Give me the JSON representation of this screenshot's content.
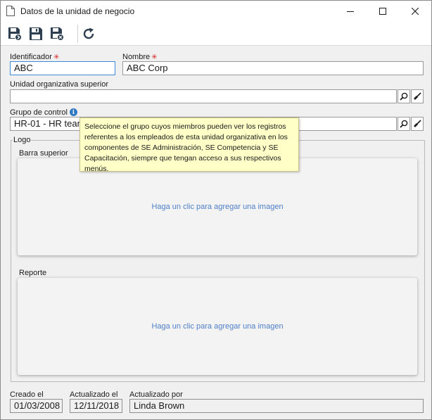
{
  "window": {
    "title": "Datos de la unidad de negocio",
    "title_icon": "document-icon",
    "controls": [
      "minimize-icon",
      "maximize-icon",
      "close-icon"
    ]
  },
  "toolbar": {
    "buttons": [
      {
        "name": "save-and-new-icon"
      },
      {
        "name": "save-icon"
      },
      {
        "name": "save-and-close-icon"
      },
      {
        "name": "refresh-icon"
      }
    ]
  },
  "form": {
    "identificador": {
      "label": "Identificador",
      "value": "ABC",
      "required": true
    },
    "nombre": {
      "label": "Nombre",
      "value": "ABC Corp",
      "required": true
    },
    "unidad_superior": {
      "label": "Unidad organizativa superior",
      "value": ""
    },
    "grupo_control": {
      "label": "Grupo de control",
      "value": "HR-01 - HR team"
    },
    "tooltip": "Seleccione el grupo cuyos miembros pueden ver los registros referentes a los empleados de esta unidad organizativa en los componentes de SE Administración, SE Competencia y SE Capacitación, siempre que tengan acceso a sus respectivos menús.",
    "logo": {
      "legend": "Logo",
      "barra_superior": {
        "label": "Barra superior",
        "placeholder": "Haga un clic para agregar una imagen"
      },
      "reporte": {
        "label": "Reporte",
        "placeholder": "Haga un clic para agregar una imagen"
      }
    },
    "creado_el": {
      "label": "Creado el",
      "value": "01/03/2008"
    },
    "actualizado_el": {
      "label": "Actualizado el",
      "value": "12/11/2018"
    },
    "actualizado_por": {
      "label": "Actualizado por",
      "value": "Linda Brown"
    }
  },
  "colors": {
    "required_marker": "#d62020",
    "link": "#4f7fc8",
    "tooltip_bg": "#ffffc8",
    "focus_border": "#3c8ad8"
  }
}
